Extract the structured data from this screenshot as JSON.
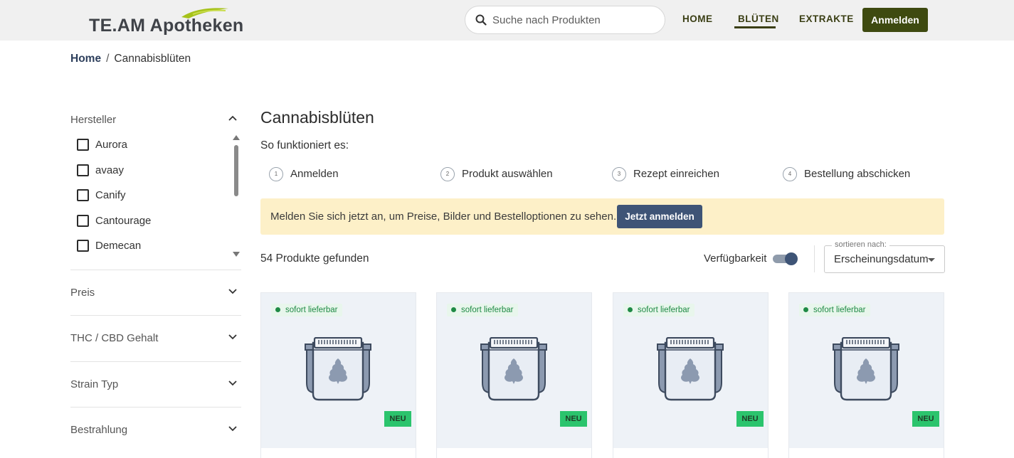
{
  "header": {
    "logo_text": "TE.AM Apotheken",
    "search_placeholder": "Suche nach Produkten",
    "nav": {
      "home": "HOME",
      "blueten": "BLÜTEN",
      "extrakte": "EXTRAKTE"
    },
    "login_label": "Anmelden"
  },
  "breadcrumb": {
    "home": "Home",
    "separator": "/",
    "current": "Cannabisblüten"
  },
  "sidebar": {
    "manufacturer": {
      "title": "Hersteller",
      "items": [
        "Aurora",
        "avaay",
        "Canify",
        "Cantourage",
        "Demecan"
      ]
    },
    "sections": [
      "Preis",
      "THC / CBD Gehalt",
      "Strain Typ",
      "Bestrahlung"
    ]
  },
  "main": {
    "title": "Cannabisblüten",
    "how_label": "So funktioniert es:",
    "steps": [
      {
        "num": "1",
        "label": "Anmelden"
      },
      {
        "num": "2",
        "label": "Produkt auswählen"
      },
      {
        "num": "3",
        "label": "Rezept einreichen"
      },
      {
        "num": "4",
        "label": "Bestellung abschicken"
      }
    ],
    "banner": {
      "text": "Melden Sie sich jetzt an, um Preise, Bilder und Bestelloptionen zu sehen.",
      "button": "Jetzt anmelden"
    },
    "count": "54 Produkte gefunden",
    "availability_label": "Verfügbarkeit",
    "availability_on": true,
    "sort": {
      "caption": "sortieren nach:",
      "value": "Erscheinungsdatum"
    },
    "products": [
      {
        "availability": "sofort lieferbar",
        "badge": "NEU"
      },
      {
        "availability": "sofort lieferbar",
        "badge": "NEU"
      },
      {
        "availability": "sofort lieferbar",
        "badge": "NEU"
      },
      {
        "availability": "sofort lieferbar",
        "badge": "NEU"
      }
    ]
  },
  "colors": {
    "brand_dark": "#3e4a10",
    "brand_green": "#a6c21a",
    "button_blue": "#3e5476",
    "banner_bg": "#fdf0c8",
    "available_green": "#1f8a45",
    "new_badge": "#2bc46d"
  }
}
